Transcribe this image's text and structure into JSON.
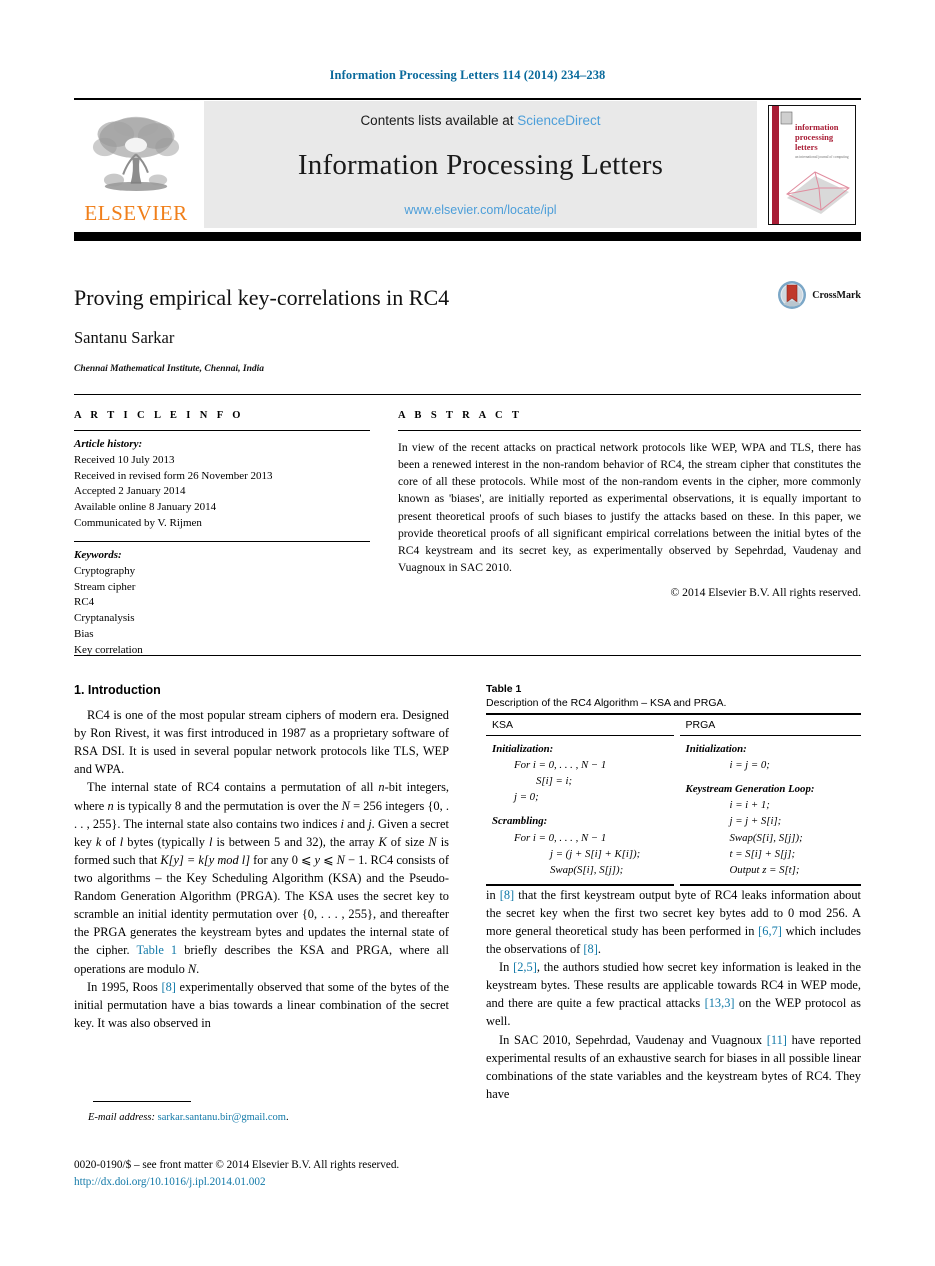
{
  "running_head": "Information Processing Letters 114 (2014) 234–238",
  "masthead": {
    "publisher_logo_label": "ELSEVIER",
    "contents_prefix": "Contents lists available at ",
    "sciencedirect": "ScienceDirect",
    "journal_title": "Information Processing Letters",
    "journal_url": "www.elsevier.com/locate/ipl",
    "cover_title_line1": "information",
    "cover_title_line2": "processing",
    "cover_title_line3": "letters"
  },
  "title_block": {
    "title": "Proving empirical key-correlations in RC4",
    "author": "Santanu Sarkar",
    "affiliation": "Chennai Mathematical Institute, Chennai, India",
    "crossmark_label": "CrossMark"
  },
  "article_info": {
    "heading": "A R T I C L E   I N F O",
    "history_label": "Article history:",
    "history": [
      "Received 10 July 2013",
      "Received in revised form 26 November 2013",
      "Accepted 2 January 2014",
      "Available online 8 January 2014",
      "Communicated by V. Rijmen"
    ],
    "keywords_label": "Keywords:",
    "keywords": [
      "Cryptography",
      "Stream cipher",
      "RC4",
      "Cryptanalysis",
      "Bias",
      "Key correlation"
    ]
  },
  "abstract": {
    "heading": "A B S T R A C T",
    "text": "In view of the recent attacks on practical network protocols like WEP, WPA and TLS, there has been a renewed interest in the non-random behavior of RC4, the stream cipher that constitutes the core of all these protocols. While most of the non-random events in the cipher, more commonly known as 'biases', are initially reported as experimental observations, it is equally important to present theoretical proofs of such biases to justify the attacks based on these. In this paper, we provide theoretical proofs of all significant empirical correlations between the initial bytes of the RC4 keystream and its secret key, as experimentally observed by Sepehrdad, Vaudenay and Vuagnoux in SAC 2010.",
    "copyright": "© 2014 Elsevier B.V. All rights reserved."
  },
  "body": {
    "section1_heading": "1. Introduction",
    "p1_a": "RC4 is one of the most popular stream ciphers of modern era. Designed by Ron Rivest, it was first introduced in 1987 as a proprietary software of RSA DSI. It is used in several popular network protocols like TLS, WEP and WPA.",
    "p2_a": "The internal state of RC4 contains a permutation of all ",
    "p2_n1": "n",
    "p2_b": "-bit integers, where ",
    "p2_n2": "n",
    "p2_c": " is typically 8 and the permutation is over the ",
    "p2_N": "N",
    "p2_d": " = 256 integers {0, . . . , 255}. The internal state also contains two indices ",
    "p2_i": "i",
    "p2_e": " and ",
    "p2_j": "j",
    "p2_f": ". Given a secret key ",
    "p2_k": "k",
    "p2_g": " of ",
    "p2_l1": "l",
    "p2_h": " bytes (typically ",
    "p2_l2": "l",
    "p2_i2": " is between 5 and 32), the array ",
    "p2_K": "K",
    "p2_j2": " of size ",
    "p2_N2": "N",
    "p2_k2": " is formed such that ",
    "p2_eq": "K[y] = k[y mod l]",
    "p2_l3": " for any 0 ⩽ ",
    "p2_y": "y",
    "p2_m": " ⩽ ",
    "p2_N3": "N",
    "p2_n3": " − 1. RC4 consists of two algorithms – the Key Scheduling Algorithm (KSA) and the Pseudo-Random Generation Algorithm (PRGA). The KSA uses the secret key to scramble an initial identity permutation over {0, . . . , 255}, and thereafter the PRGA generates the keystream bytes and updates the internal state of the cipher. ",
    "p2_tableref": "Table 1",
    "p2_tail": " briefly describes the KSA and PRGA, where all operations are modulo ",
    "p2_N4": "N",
    "p2_end": ".",
    "p3_a": "In 1995, Roos ",
    "p3_ref1": "[8]",
    "p3_b": " experimentally observed that some of the bytes of the initial permutation have a bias towards a linear combination of the secret key. It was also observed in ",
    "p3_ref2": "[8]",
    "p3_c": " that the first keystream output byte of RC4 leaks information about the secret key when the first two secret key bytes add to 0 mod 256. A more general theoretical study has been performed in ",
    "p3_ref3": "[6,7]",
    "p3_d": " which includes the observations of ",
    "p3_ref4": "[8]",
    "p3_e": ".",
    "p4_a": "In ",
    "p4_ref1": "[2,5]",
    "p4_b": ", the authors studied how secret key information is leaked in the keystream bytes. These results are applicable towards RC4 in WEP mode, and there are quite a few practical attacks ",
    "p4_ref2": "[13,3]",
    "p4_c": " on the WEP protocol as well.",
    "p5_a": "In SAC 2010, Sepehrdad, Vaudenay and Vuagnoux ",
    "p5_ref1": "[11]",
    "p5_b": " have reported experimental results of an exhaustive search for biases in all possible linear combinations of the state variables and the keystream bytes of RC4. They have"
  },
  "table1": {
    "number": "Table 1",
    "caption": "Description of the RC4 Algorithm – KSA and PRGA.",
    "col1_header": "KSA",
    "col2_header": "PRGA",
    "ksa": {
      "init_label": "Initialization:",
      "init_line1": "For i = 0, . . . , N − 1",
      "init_line2": "S[i] = i;",
      "init_line3": "j = 0;",
      "scramble_label": "Scrambling:",
      "scr_line1": "For i = 0, . . . , N − 1",
      "scr_line2": "j = (j + S[i] + K[i]);",
      "scr_line3": "Swap(S[i], S[j]);"
    },
    "prga": {
      "init_label": "Initialization:",
      "init_line1": "i = j = 0;",
      "loop_label": "Keystream Generation Loop:",
      "loop_line1": "i = i + 1;",
      "loop_line2": "j = j + S[i];",
      "loop_line3": "Swap(S[i], S[j]);",
      "loop_line4": "t = S[i] + S[j];",
      "loop_line5": "Output z = S[t];"
    }
  },
  "footnote": {
    "label": "E-mail address:",
    "email": "sarkar.santanu.bir@gmail.com",
    "trailing": "."
  },
  "footer": {
    "issn_line": "0020-0190/$ – see front matter  © 2014 Elsevier B.V. All rights reserved.",
    "doi": "http://dx.doi.org/10.1016/j.ipl.2014.01.002"
  },
  "colors": {
    "link_blue": "#1279a8",
    "sciencedirect_blue": "#4c9ed9",
    "elsevier_orange": "#F07F1A",
    "header_teal": "#0a6a9c"
  }
}
